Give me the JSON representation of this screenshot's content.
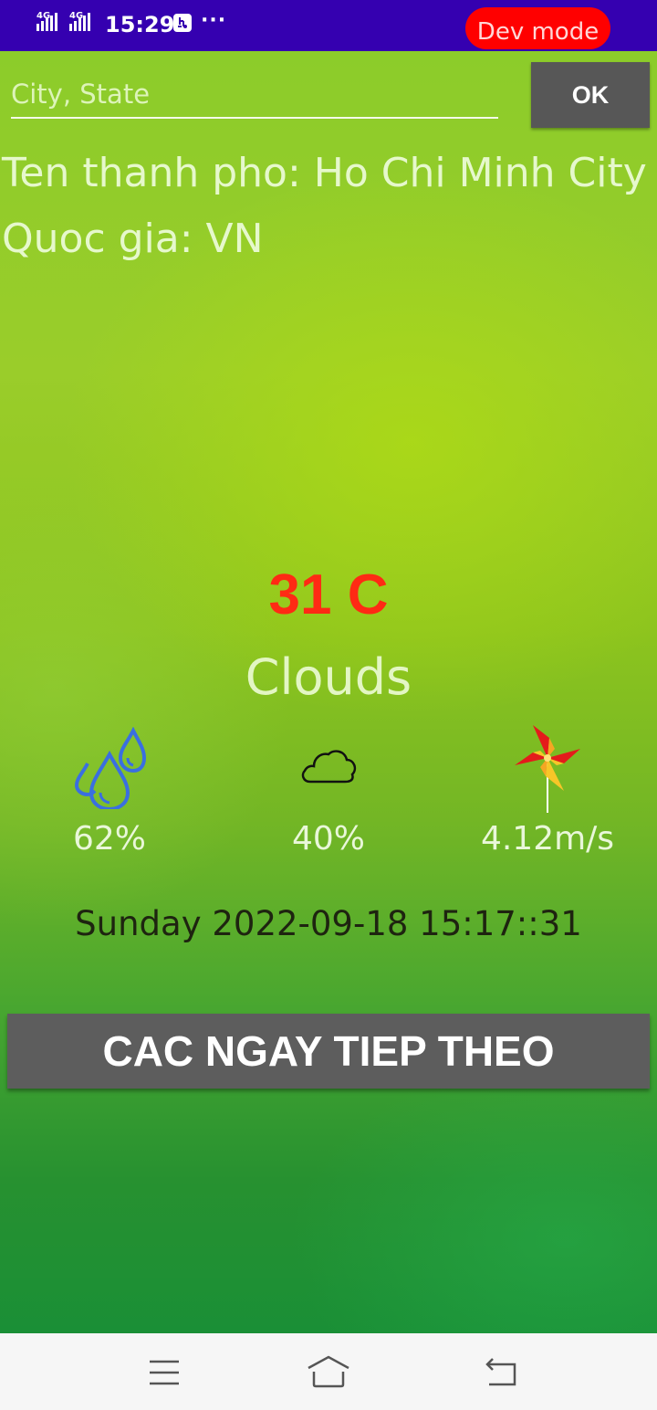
{
  "status_bar": {
    "network_1": "4G",
    "network_2": "4G",
    "time": "15:29",
    "more": "···",
    "dev_mode": "Dev mode",
    "icons": [
      "signal-icon",
      "usb-debug-icon",
      "more-icon"
    ]
  },
  "search": {
    "placeholder": "City, State",
    "value": "",
    "ok_label": "OK"
  },
  "location": {
    "city_line": "Ten thanh pho: Ho Chi Minh City",
    "country_line": "Quoc gia: VN"
  },
  "weather": {
    "temperature": "31 C",
    "condition": "Clouds",
    "humidity": "62%",
    "cloudiness": "40%",
    "wind_speed": "4.12m/s",
    "datetime": "Sunday 2022-09-18 15:17::31",
    "icons": [
      "water-drops-icon",
      "cloud-icon",
      "pinwheel-icon"
    ]
  },
  "actions": {
    "next_days_label": "CAC NGAY TIEP THEO"
  },
  "nav_bar": {
    "icons": [
      "menu-icon",
      "home-icon",
      "back-icon"
    ]
  },
  "colors": {
    "status_bar": "#3500b0",
    "dev_badge": "#ff0000",
    "temperature": "#ff2a14",
    "button": "#5d5d5d",
    "humidity_icon": "#3a6fe0"
  }
}
